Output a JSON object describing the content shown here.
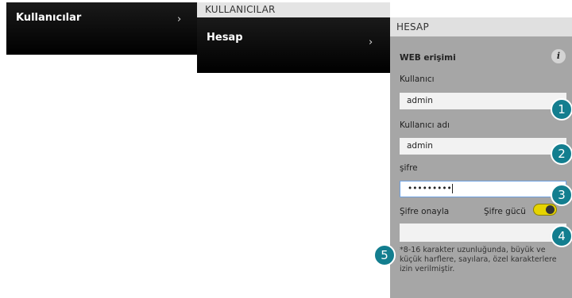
{
  "menu1": {
    "label": "Kullanıcılar",
    "chevron": "›"
  },
  "menu2": {
    "header": "KULLANICILAR",
    "label": "Hesap",
    "chevron": "›"
  },
  "panel": {
    "header": "HESAP",
    "section_title": "WEB erişimi",
    "info_icon": "i",
    "user_label": "Kullanıcı",
    "user_value": "admin",
    "username_label": "Kullanıcı adı",
    "username_value": "admin",
    "password_label": "şifre",
    "password_value": "•••••••••",
    "confirm_label": "Şifre onayla",
    "confirm_value": "",
    "strength_label": "Şifre gücü",
    "note": "*8-16 karakter uzunluğunda, büyük ve küçük harflere, sayılara, özel karakterlere izin verilmiştir."
  },
  "badges": [
    "1",
    "2",
    "3",
    "4",
    "5"
  ],
  "colors": {
    "badge": "#137e8f",
    "toggle": "#e6d400",
    "menu_bg": "#000000"
  }
}
